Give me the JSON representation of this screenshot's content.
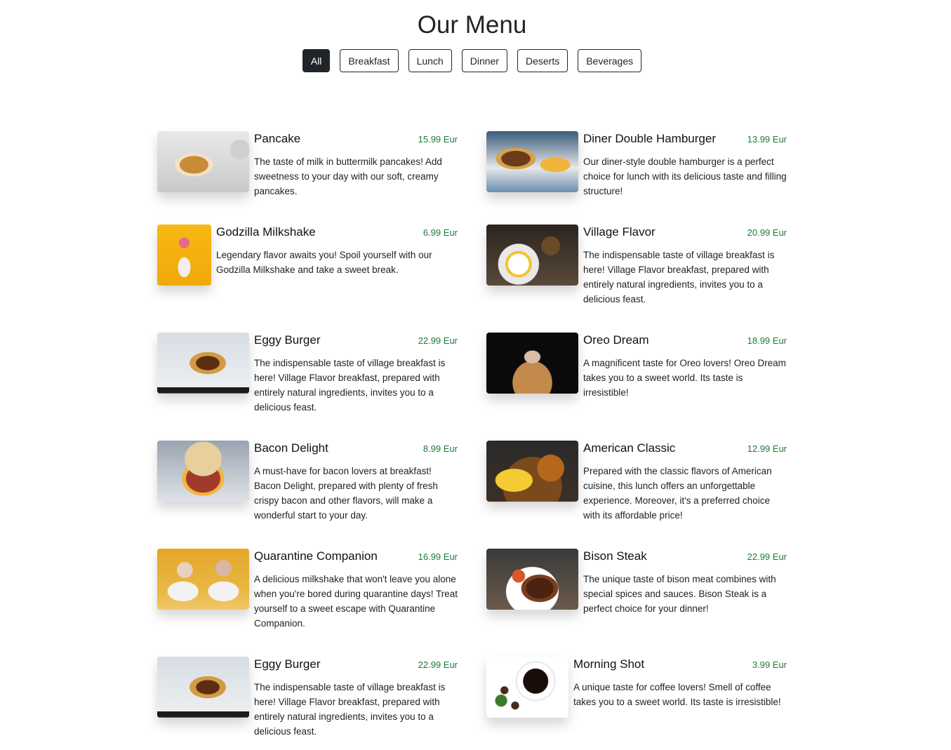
{
  "page": {
    "title": "Our Menu"
  },
  "filters": [
    {
      "label": "All",
      "active": true
    },
    {
      "label": "Breakfast",
      "active": false
    },
    {
      "label": "Lunch",
      "active": false
    },
    {
      "label": "Dinner",
      "active": false
    },
    {
      "label": "Deserts",
      "active": false
    },
    {
      "label": "Beverages",
      "active": false
    }
  ],
  "colors": {
    "price": "#1e7a3a",
    "active_filter": "#212529"
  },
  "items": [
    {
      "name": "Pancake",
      "price": "15.99 Eur",
      "image": "pancake-photo",
      "description": "The taste of milk in buttermilk pancakes! Add sweetness to your day with our soft, creamy pancakes."
    },
    {
      "name": "Diner Double Hamburger",
      "price": "13.99 Eur",
      "image": "hamburger-photo",
      "description": "Our diner-style double hamburger is a perfect choice for lunch with its delicious taste and filling structure!"
    },
    {
      "name": "Godzilla Milkshake",
      "price": "6.99 Eur",
      "image": "milkshake-photo",
      "description": "Legendary flavor awaits you! Spoil yourself with our Godzilla Milkshake and take a sweet break."
    },
    {
      "name": "Village Flavor",
      "price": "20.99 Eur",
      "image": "village-breakfast-photo",
      "description": "The indispensable taste of village breakfast is here! Village Flavor breakfast, prepared with entirely natural ingredients, invites you to a delicious feast."
    },
    {
      "name": "Eggy Burger",
      "price": "22.99 Eur",
      "image": "egg-burger-photo",
      "description": "The indispensable taste of village breakfast is here! Village Flavor breakfast, prepared with entirely natural ingredients, invites you to a delicious feast."
    },
    {
      "name": "Oreo Dream",
      "price": "18.99 Eur",
      "image": "oreo-shake-photo",
      "description": "A magnificent taste for Oreo lovers! Oreo Dream takes you to a sweet world. Its taste is irresistible!"
    },
    {
      "name": "Bacon Delight",
      "price": "8.99 Eur",
      "image": "bacon-sandwich-photo",
      "description": "A must-have for bacon lovers at breakfast! Bacon Delight, prepared with plenty of fresh crispy bacon and other flavors, will make a wonderful start to your day."
    },
    {
      "name": "American Classic",
      "price": "12.99 Eur",
      "image": "burger-fries-photo",
      "description": "Prepared with the classic flavors of American cuisine, this lunch offers an unforgettable experience. Moreover, it's a preferred choice with its affordable price!"
    },
    {
      "name": "Quarantine Companion",
      "price": "16.99 Eur",
      "image": "couple-milkshake-photo",
      "description": "A delicious milkshake that won't leave you alone when you're bored during quarantine days! Treat yourself to a sweet escape with Quarantine Companion."
    },
    {
      "name": "Bison Steak",
      "price": "22.99 Eur",
      "image": "steak-photo",
      "description": "The unique taste of bison meat combines with special spices and sauces. Bison Steak is a perfect choice for your dinner!"
    },
    {
      "name": "Eggy Burger",
      "price": "22.99 Eur",
      "image": "egg-burger-photo",
      "description": "The indispensable taste of village breakfast is here! Village Flavor breakfast, prepared with entirely natural ingredients, invites you to a delicious feast."
    },
    {
      "name": "Morning Shot",
      "price": "3.99 Eur",
      "image": "coffee-cup-photo",
      "description": "A unique taste for coffee lovers! Smell of coffee takes you to a sweet world. Its taste is irresistible!"
    }
  ]
}
